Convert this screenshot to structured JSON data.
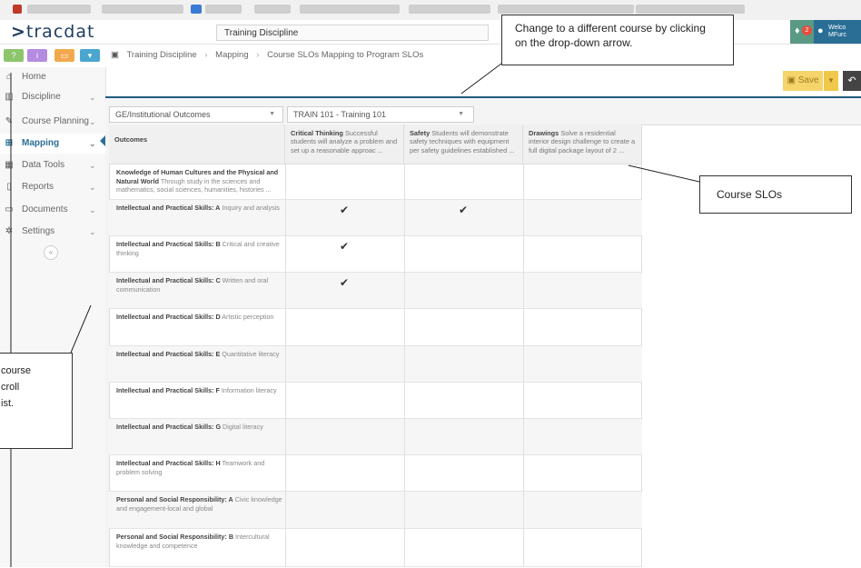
{
  "app": {
    "logo_text": "tracdat",
    "window_title": "Training Discipline",
    "user_text": "Welco MFurc",
    "notification_count": "2"
  },
  "sidebar": {
    "items": [
      {
        "label": "Home",
        "icon": "home-icon",
        "has_chevron": false
      },
      {
        "label": "Discipline",
        "icon": "building-icon",
        "has_chevron": true
      },
      {
        "label": "Course Planning",
        "icon": "edit-icon",
        "has_chevron": true
      },
      {
        "label": "Mapping",
        "icon": "sitemap-icon",
        "has_chevron": true,
        "active": true
      },
      {
        "label": "Data Tools",
        "icon": "table-icon",
        "has_chevron": true
      },
      {
        "label": "Reports",
        "icon": "file-icon",
        "has_chevron": true
      },
      {
        "label": "Documents",
        "icon": "folder-icon",
        "has_chevron": true
      },
      {
        "label": "Settings",
        "icon": "gear-icon",
        "has_chevron": true
      }
    ],
    "quick_buttons": [
      {
        "glyph": "?",
        "color": "#8cc56b"
      },
      {
        "glyph": "i",
        "color": "#b38be0"
      },
      {
        "glyph": "▭",
        "color": "#f2a94e"
      },
      {
        "glyph": "▾",
        "color": "#4aa6cf"
      }
    ]
  },
  "breadcrumb": {
    "items": [
      "Training Discipline",
      "Mapping",
      "Course SLOs Mapping to Program SLOs"
    ],
    "separator": "›"
  },
  "toolbar": {
    "save_label": "Save"
  },
  "filters": {
    "outcome_set": "GE/Institutional Outcomes",
    "course": "TRAIN 101 - Training 101"
  },
  "grid": {
    "row_header": "Outcomes",
    "columns": [
      {
        "title": "Critical Thinking",
        "desc": "Successful students will analyze a problem and set up a reasonable approac ..."
      },
      {
        "title": "Safety",
        "desc": "Students will demonstrate safety techniques with equipment per safety guidelines established ..."
      },
      {
        "title": "Drawings",
        "desc": "Solve a residential interior design challenge to create a full digital package layout of 2 ..."
      }
    ],
    "rows": [
      {
        "title": "Knowledge of Human Cultures and the Physical and Natural World",
        "desc": "Through study in the sciences and mathematics, social sciences, humanities, histories ...",
        "checks": [
          false,
          false,
          false
        ]
      },
      {
        "title": "Intellectual and Practical Skills: A",
        "desc": "Inquiry and analysis",
        "checks": [
          true,
          true,
          false
        ]
      },
      {
        "title": "Intellectual and Practical Skills: B",
        "desc": "Critical and creative thinking",
        "checks": [
          true,
          false,
          false
        ]
      },
      {
        "title": "Intellectual and Practical Skills: C",
        "desc": "Written and oral communication",
        "checks": [
          true,
          false,
          false
        ]
      },
      {
        "title": "Intellectual and Practical Skills: D",
        "desc": "Artistic perception",
        "checks": [
          false,
          false,
          false
        ]
      },
      {
        "title": "Intellectual and Practical Skills: E",
        "desc": "Quantitative literacy",
        "checks": [
          false,
          false,
          false
        ]
      },
      {
        "title": "Intellectual and Practical Skills: F",
        "desc": "Information literacy",
        "checks": [
          false,
          false,
          false
        ]
      },
      {
        "title": "Intellectual and Practical Skills: G",
        "desc": "Digital literacy",
        "checks": [
          false,
          false,
          false
        ]
      },
      {
        "title": "Intellectual and Practical Skills: H",
        "desc": "Teamwork and problem solving",
        "checks": [
          false,
          false,
          false
        ]
      },
      {
        "title": "Personal and Social Responsibility: A",
        "desc": "Civic knowledge and engagement-local and global",
        "checks": [
          false,
          false,
          false
        ]
      },
      {
        "title": "Personal and Social Responsibility: B",
        "desc": "Intercultural knowledge and competence",
        "checks": [
          false,
          false,
          false
        ]
      }
    ]
  },
  "callouts": {
    "change_course": "Change to a different course by clicking on the drop-down arrow.",
    "course_slos": "Course SLOs",
    "left_note_lines": [
      "course",
      "croll",
      "ist."
    ]
  }
}
